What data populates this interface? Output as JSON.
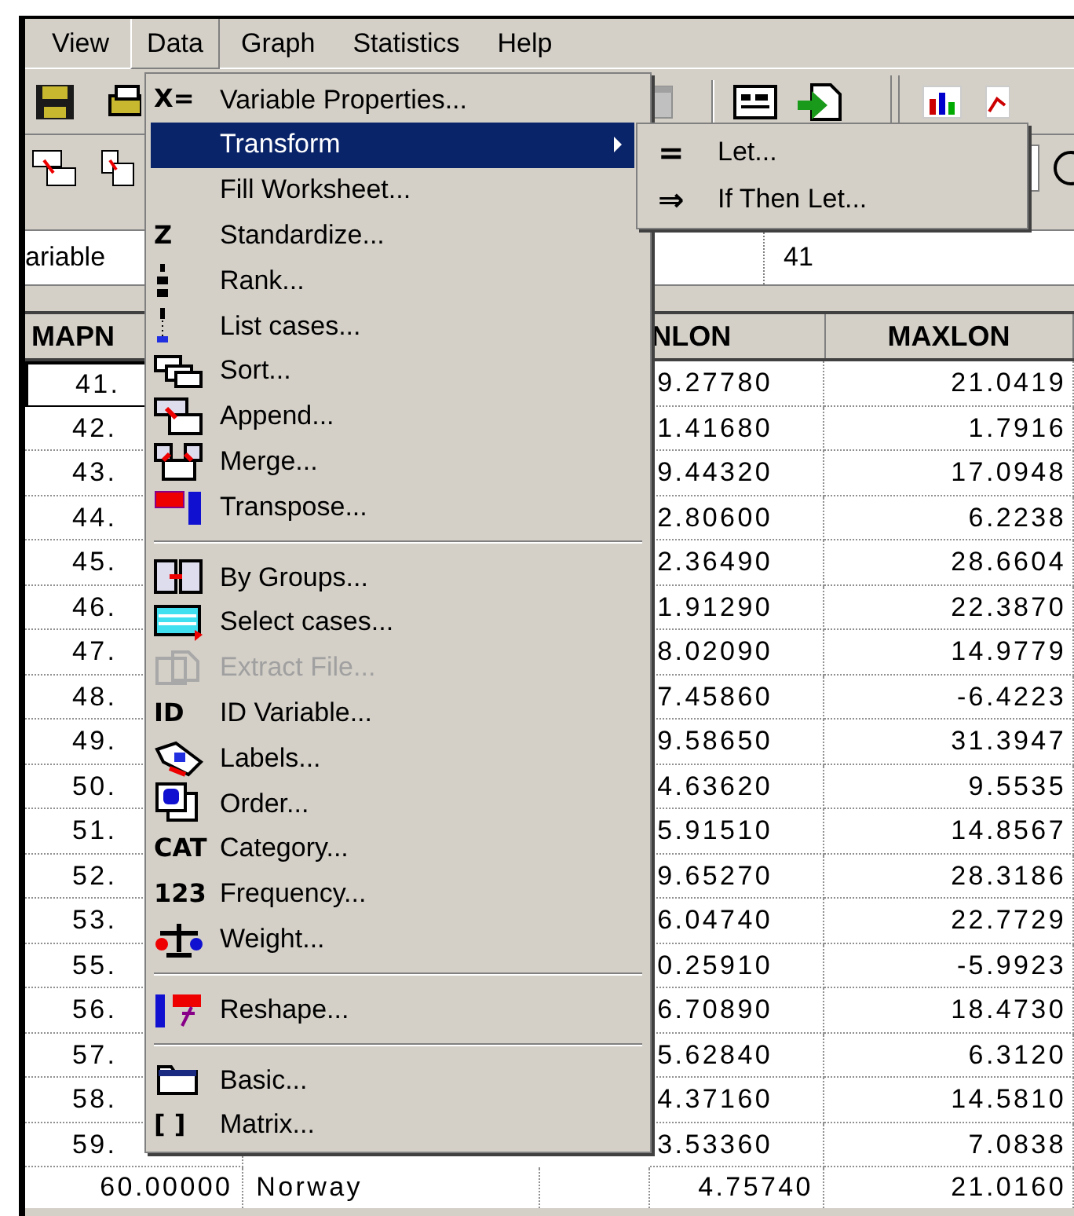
{
  "menu_bar": [
    {
      "label": "View",
      "selected": false
    },
    {
      "label": "Data",
      "selected": true
    },
    {
      "label": "Graph",
      "selected": false
    },
    {
      "label": "Statistics",
      "selected": false
    },
    {
      "label": "Help",
      "selected": false
    }
  ],
  "name_bar": {
    "variable": "ariable",
    "value": "41"
  },
  "table": {
    "columns": [
      "MAPN",
      "NLON",
      "MAXLON"
    ],
    "rows": [
      {
        "cells": [
          "41.",
          "9.27780",
          "21.0419"
        ],
        "selected": true
      },
      {
        "cells": [
          "42.",
          "1.41680",
          "1.7916"
        ],
        "selected": false
      },
      {
        "cells": [
          "43.",
          "9.44320",
          "17.0948"
        ],
        "selected": false
      },
      {
        "cells": [
          "44.",
          "2.80600",
          "6.2238"
        ],
        "selected": false
      },
      {
        "cells": [
          "45.",
          "2.36490",
          "28.6604"
        ],
        "selected": false
      },
      {
        "cells": [
          "46.",
          "1.91290",
          "22.3870"
        ],
        "selected": false
      },
      {
        "cells": [
          "47.",
          "8.02090",
          "14.9779"
        ],
        "selected": false
      },
      {
        "cells": [
          "48.",
          "7.45860",
          "-6.4223"
        ],
        "selected": false
      },
      {
        "cells": [
          "49.",
          "9.58650",
          "31.3947"
        ],
        "selected": false
      },
      {
        "cells": [
          "50.",
          "4.63620",
          "9.5535"
        ],
        "selected": false
      },
      {
        "cells": [
          "51.",
          "5.91510",
          "14.8567"
        ],
        "selected": false
      },
      {
        "cells": [
          "52.",
          "9.65270",
          "28.3186"
        ],
        "selected": false
      },
      {
        "cells": [
          "53.",
          "6.04740",
          "22.7729"
        ],
        "selected": false
      },
      {
        "cells": [
          "55.",
          "0.25910",
          "-5.9923"
        ],
        "selected": false
      },
      {
        "cells": [
          "56.",
          "6.70890",
          "18.4730"
        ],
        "selected": false
      },
      {
        "cells": [
          "57.",
          "5.62840",
          "6.3120"
        ],
        "selected": false
      },
      {
        "cells": [
          "58.",
          "4.37160",
          "14.5810"
        ],
        "selected": false
      },
      {
        "cells": [
          "59.",
          "3.53360",
          "7.0838"
        ],
        "selected": false
      }
    ],
    "last_row": {
      "cells": [
        "60.00000",
        "Norway",
        "4.75740",
        "21.0160"
      ]
    }
  },
  "data_menu": [
    {
      "kind": "glyph",
      "glyph": "X=",
      "label": "Variable Properties...",
      "selected": false,
      "disabled": false
    },
    {
      "kind": "plain",
      "label": "Transform",
      "selected": true,
      "disabled": false,
      "submenu": true
    },
    {
      "kind": "plain",
      "label": "Fill Worksheet...",
      "selected": false,
      "disabled": false
    },
    {
      "kind": "glyph",
      "glyph": "Z",
      "label": "Standardize...",
      "selected": false,
      "disabled": false
    },
    {
      "kind": "icon",
      "label": "Rank...",
      "selected": false,
      "disabled": false
    },
    {
      "kind": "icon",
      "label": "List cases...",
      "selected": false,
      "disabled": false
    },
    {
      "kind": "icon",
      "label": "Sort...",
      "selected": false,
      "disabled": false
    },
    {
      "kind": "icon",
      "label": "Append...",
      "selected": false,
      "disabled": false
    },
    {
      "kind": "icon",
      "label": "Merge...",
      "selected": false,
      "disabled": false
    },
    {
      "kind": "icon",
      "label": "Transpose...",
      "selected": false,
      "disabled": false
    },
    {
      "kind": "separator"
    },
    {
      "kind": "icon",
      "label": "By Groups...",
      "selected": false,
      "disabled": false
    },
    {
      "kind": "icon",
      "label": "Select cases...",
      "selected": false,
      "disabled": false
    },
    {
      "kind": "icon",
      "label": "Extract File...",
      "selected": false,
      "disabled": true
    },
    {
      "kind": "glyph",
      "glyph": "ID",
      "label": "ID Variable...",
      "selected": false,
      "disabled": false
    },
    {
      "kind": "icon",
      "label": "Labels...",
      "selected": false,
      "disabled": false
    },
    {
      "kind": "icon",
      "label": "Order...",
      "selected": false,
      "disabled": false
    },
    {
      "kind": "glyph",
      "glyph": "CAT",
      "label": "Category...",
      "selected": false,
      "disabled": false
    },
    {
      "kind": "glyph",
      "glyph": "123",
      "label": "Frequency...",
      "selected": false,
      "disabled": false
    },
    {
      "kind": "icon",
      "label": "Weight...",
      "selected": false,
      "disabled": false
    },
    {
      "kind": "separator"
    },
    {
      "kind": "icon",
      "label": "Reshape...",
      "selected": false,
      "disabled": false
    },
    {
      "kind": "separator"
    },
    {
      "kind": "icon",
      "label": "Basic...",
      "selected": false,
      "disabled": false
    },
    {
      "kind": "glyph",
      "glyph": "[ ]",
      "label": "Matrix...",
      "selected": false,
      "disabled": false
    }
  ],
  "transform_submenu": [
    {
      "glyph": "=",
      "label": "Let...",
      "selected": false
    },
    {
      "glyph": "⇒",
      "label": "If Then Let...",
      "selected": false
    }
  ]
}
